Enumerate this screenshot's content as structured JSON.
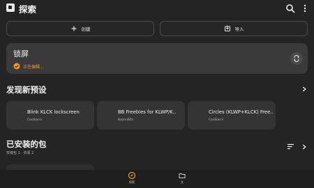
{
  "app": {
    "title": "探索"
  },
  "toolbar": {
    "create_label": "创建",
    "import_label": "导入"
  },
  "current_preset": {
    "name": "锁屏",
    "status": "正在编辑..."
  },
  "sections": {
    "discover_title": "发现新预设",
    "installed_title": "已安装的包",
    "installed_subtitle": "安装包 1 · 资源 2"
  },
  "preset_list": [
    {
      "title": "Blink KLCK lockscreen",
      "author": "Coolkarni"
    },
    {
      "title": "BB Freebies for KLWP/K‥",
      "author": "BazonBits"
    },
    {
      "title": "Circles (KLWP+KLCK) Free‥",
      "author": "Coolkarni"
    }
  ],
  "bottom_nav": {
    "explore_label": "探索",
    "files_label": "文"
  },
  "colors": {
    "background": "#242424",
    "accent": "#f29a2e",
    "card": "#3a3a3a"
  },
  "icons": {
    "search": "search-icon",
    "more": "more-vertical-icon",
    "create": "plus-icon",
    "import": "import-icon",
    "status": "check-circle-icon",
    "sync": "sync-icon",
    "discover": "chevron-right-icon",
    "sort": "sort-icon",
    "explore": "compass-icon",
    "files": "folder-icon"
  }
}
